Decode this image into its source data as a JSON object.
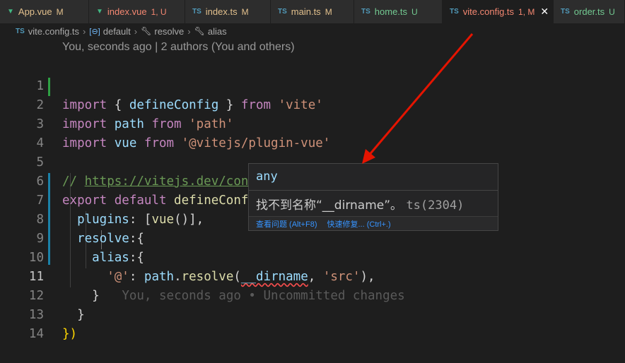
{
  "tabs": [
    {
      "icon": "vue",
      "name": "App.vue",
      "status": "M",
      "active": false
    },
    {
      "icon": "vue",
      "name": "index.vue",
      "status": "1, U",
      "active": false
    },
    {
      "icon": "ts",
      "name": "index.ts",
      "status": "M",
      "active": false
    },
    {
      "icon": "ts",
      "name": "main.ts",
      "status": "M",
      "active": false
    },
    {
      "icon": "ts",
      "name": "home.ts",
      "status": "U",
      "active": false
    },
    {
      "icon": "ts",
      "name": "vite.config.ts",
      "status": "1, M",
      "active": true
    },
    {
      "icon": "ts",
      "name": "order.ts",
      "status": "U",
      "active": false
    }
  ],
  "tab_icons": {
    "ts": "TS"
  },
  "breadcrumb": {
    "file": "vite.config.ts",
    "items": [
      "default",
      "resolve",
      "alias"
    ]
  },
  "codelens": "You, seconds ago | 2 authors (You and others)",
  "line_numbers": [
    "1",
    "2",
    "3",
    "4",
    "5",
    "6",
    "7",
    "8",
    "9",
    "10",
    "11",
    "12",
    "13",
    "14"
  ],
  "code": {
    "l1": {
      "k": "import",
      "p1": " { ",
      "v": "defineConfig",
      "p2": " } ",
      "k2": "from",
      "s": " 'vite'"
    },
    "l2": {
      "k": "import",
      "v": " path ",
      "k2": "from",
      "s": " 'path'"
    },
    "l3": {
      "k": "import",
      "v": " vue ",
      "k2": "from",
      "s": " '@vitejs/plugin-vue'"
    },
    "l5": {
      "c": "// ",
      "link": "https://vitejs.dev/config/"
    },
    "l6": {
      "k": "export",
      "k2": " default ",
      "f": "defineConfig",
      "b": "({"
    },
    "l7": {
      "v": "plugins",
      "p": ": [",
      "f": "vue",
      "p2": "()],"
    },
    "l8": {
      "v": "resolve",
      "p": ":{"
    },
    "l9": {
      "v": "alias",
      "p": ":{"
    },
    "l10": {
      "s1": "'@'",
      "p1": ": ",
      "v1": "path",
      "p2": ".",
      "f": "resolve",
      "p3": "(",
      "e": "__dirname",
      "p4": ", ",
      "s2": "'src'",
      "p5": "),"
    },
    "l11": {
      "p": "}",
      "ghost": "You, seconds ago • Uncommitted changes"
    },
    "l12": {
      "p": "}"
    },
    "l13": {
      "p": "})"
    }
  },
  "hover": {
    "type": "any",
    "message": "找不到名称“__dirname”。",
    "code": "ts(2304)",
    "action1": "查看问题 (Alt+F8)",
    "action2": "快速修复... (Ctrl+.)"
  },
  "colors": {
    "accent": "#e51400",
    "error": "#f14c4c",
    "link": "#3794ff"
  }
}
